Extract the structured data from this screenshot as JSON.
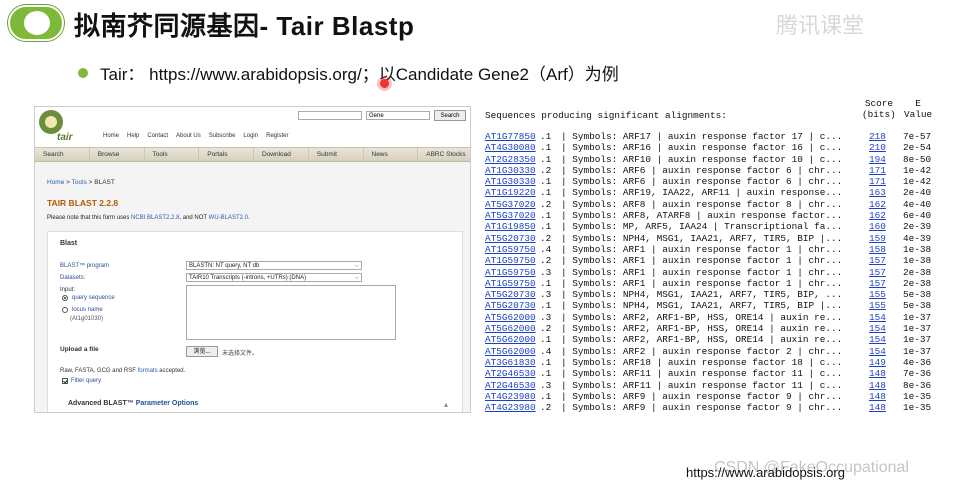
{
  "slide": {
    "title": "拟南芥同源基因- Tair Blastp",
    "bullet": "Tair： https://www.arabidopsis.org/；以Candidate Gene2（Arf）为例",
    "watermark": "腾讯课堂",
    "footer_url": "https://www.arabidopsis.org",
    "csdn_watermark": "CSDN @FakeOccupational"
  },
  "tair": {
    "logo_text": "tair",
    "search_select": "Gene",
    "search_button": "Search",
    "top_links": [
      "Home",
      "Help",
      "Contact",
      "About Us",
      "Subscribe",
      "Login",
      "Register"
    ],
    "nav": [
      "Search",
      "Browse",
      "Tools",
      "Portals",
      "Download",
      "Submit",
      "News",
      "ABRC Stocks"
    ],
    "breadcrumb_home": "Home",
    "breadcrumb_sep1": " > ",
    "breadcrumb_tools": "Tools",
    "breadcrumb_sep2": " > ",
    "breadcrumb_current": "BLAST",
    "page_title": "TAIR BLAST 2.2.8",
    "note_prefix": "Please note that this form uses ",
    "note_link1": "NCBI BLAST2.2.8",
    "note_mid": ", and NOT ",
    "note_link2": "WU-BLAST2.0",
    "note_suffix": ".",
    "form": {
      "section": "Blast",
      "program_label": "BLAST™ program",
      "program_value": "BLASTN: NT query, NT db",
      "datasets_label": "Datasets:",
      "datasets_value": "TAIR10 Transcripts (-introns, +UTRs) (DNA)",
      "input_label": "Input:",
      "radio_query": "query sequence",
      "radio_locus": "locus name",
      "locus_example": "(At1g01030)",
      "upload_label": "Upload a file",
      "browse_button": "浏览...",
      "no_file": "未选择文件。",
      "formats_prefix": "Raw, FASTA, GCG and RSF ",
      "formats_link": "formats",
      "formats_suffix": " accepted.",
      "filter_label": "Filter query",
      "advanced_prefix": "Advanced BLAST™ ",
      "advanced_link": "Parameter Options"
    }
  },
  "alignments": {
    "heading": "Sequences producing significant alignments:",
    "score_header": "Score\n(bits)",
    "e_header": "E\nValue",
    "rows": [
      {
        "acc": "AT1G77850",
        "ver": ".1",
        "desc": "| Symbols: ARF17 | auxin response factor 17 | c...",
        "score": "218",
        "evalue": "7e-57"
      },
      {
        "acc": "AT4G30080",
        "ver": ".1",
        "desc": "| Symbols: ARF16 | auxin response factor 16 | c...",
        "score": "210",
        "evalue": "2e-54"
      },
      {
        "acc": "AT2G28350",
        "ver": ".1",
        "desc": "| Symbols: ARF10 | auxin response factor 10 | c...",
        "score": "194",
        "evalue": "8e-50"
      },
      {
        "acc": "AT1G30330",
        "ver": ".2",
        "desc": "| Symbols: ARF6 | auxin response factor 6 | chr...",
        "score": "171",
        "evalue": "1e-42"
      },
      {
        "acc": "AT1G30330",
        "ver": ".1",
        "desc": "| Symbols: ARF6 | auxin response factor 6 | chr...",
        "score": "171",
        "evalue": "1e-42"
      },
      {
        "acc": "AT1G19220",
        "ver": ".1",
        "desc": "| Symbols: ARF19, IAA22, ARF11 | auxin response...",
        "score": "163",
        "evalue": "2e-40"
      },
      {
        "acc": "AT5G37020",
        "ver": ".2",
        "desc": "| Symbols: ARF8 | auxin response factor 8 | chr...",
        "score": "162",
        "evalue": "4e-40"
      },
      {
        "acc": "AT5G37020",
        "ver": ".1",
        "desc": "| Symbols: ARF8, ATARF8 | auxin response factor...",
        "score": "162",
        "evalue": "6e-40"
      },
      {
        "acc": "AT1G19850",
        "ver": ".1",
        "desc": "| Symbols: MP, ARF5, IAA24 | Transcriptional fa...",
        "score": "160",
        "evalue": "2e-39"
      },
      {
        "acc": "AT5G20730",
        "ver": ".2",
        "desc": "| Symbols: NPH4, MSG1, IAA21, ARF7, TIR5, BIP |...",
        "score": "159",
        "evalue": "4e-39"
      },
      {
        "acc": "AT1G59750",
        "ver": ".4",
        "desc": "| Symbols: ARF1 | auxin response factor 1 | chr...",
        "score": "158",
        "evalue": "1e-38"
      },
      {
        "acc": "AT1G59750",
        "ver": ".2",
        "desc": "| Symbols: ARF1 | auxin response factor 1 | chr...",
        "score": "157",
        "evalue": "1e-38"
      },
      {
        "acc": "AT1G59750",
        "ver": ".3",
        "desc": "| Symbols: ARF1 | auxin response factor 1 | chr...",
        "score": "157",
        "evalue": "2e-38"
      },
      {
        "acc": "AT1G59750",
        "ver": ".1",
        "desc": "| Symbols: ARF1 | auxin response factor 1 | chr...",
        "score": "157",
        "evalue": "2e-38"
      },
      {
        "acc": "AT5G20730",
        "ver": ".3",
        "desc": "| Symbols: NPH4, MSG1, IAA21, ARF7, TIR5, BIP, ...",
        "score": "155",
        "evalue": "5e-38"
      },
      {
        "acc": "AT5G20730",
        "ver": ".1",
        "desc": "| Symbols: NPH4, MSG1, IAA21, ARF7, TIR5, BIP |...",
        "score": "155",
        "evalue": "5e-38"
      },
      {
        "acc": "AT5G62000",
        "ver": ".3",
        "desc": "| Symbols: ARF2, ARF1-BP, HSS, ORE14 | auxin re...",
        "score": "154",
        "evalue": "1e-37"
      },
      {
        "acc": "AT5G62000",
        "ver": ".2",
        "desc": "| Symbols: ARF2, ARF1-BP, HSS, ORE14 | auxin re...",
        "score": "154",
        "evalue": "1e-37"
      },
      {
        "acc": "AT5G62000",
        "ver": ".1",
        "desc": "| Symbols: ARF2, ARF1-BP, HSS, ORE14 | auxin re...",
        "score": "154",
        "evalue": "1e-37"
      },
      {
        "acc": "AT5G62000",
        "ver": ".4",
        "desc": "| Symbols: ARF2 | auxin response factor 2 | chr...",
        "score": "154",
        "evalue": "1e-37"
      },
      {
        "acc": "AT3G61830",
        "ver": ".1",
        "desc": "| Symbols: ARF18 | auxin response factor 18 | c...",
        "score": "149",
        "evalue": "4e-36"
      },
      {
        "acc": "AT2G46530",
        "ver": ".1",
        "desc": "| Symbols: ARF11 | auxin response factor 11 | c...",
        "score": "148",
        "evalue": "7e-36"
      },
      {
        "acc": "AT2G46530",
        "ver": ".3",
        "desc": "| Symbols: ARF11 | auxin response factor 11 | c...",
        "score": "148",
        "evalue": "8e-36"
      },
      {
        "acc": "AT4G23980",
        "ver": ".1",
        "desc": "| Symbols: ARF9 | auxin response factor 9 | chr...",
        "score": "148",
        "evalue": "1e-35"
      },
      {
        "acc": "AT4G23980",
        "ver": ".2",
        "desc": "| Symbols: ARF9 | auxin response factor 9 | chr...",
        "score": "148",
        "evalue": "1e-35"
      }
    ]
  },
  "colors": {
    "accent_green": "#7fb93a",
    "tair_title_orange": "#b85a00",
    "link_blue": "#1a3fc9"
  }
}
